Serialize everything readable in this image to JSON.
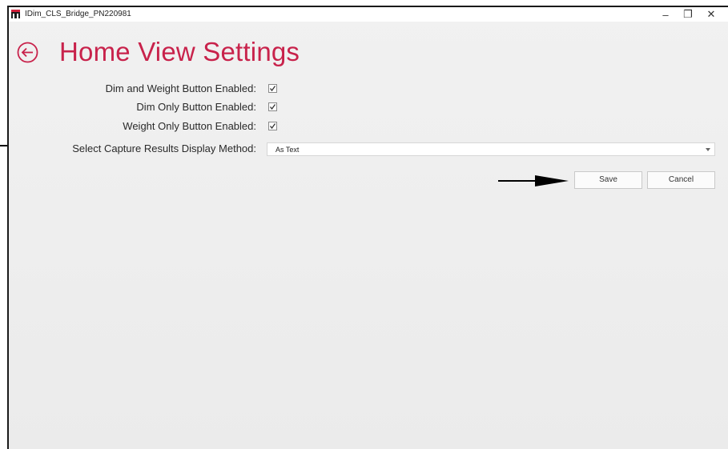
{
  "window": {
    "title": "IDim_CLS_Bridge_PN220981",
    "minimize_glyph": "–",
    "restore_glyph": "❐",
    "close_glyph": "✕"
  },
  "page": {
    "title": "Home View Settings",
    "back_icon": "back-arrow-circle-icon"
  },
  "settings": {
    "dim_and_weight": {
      "label": "Dim and Weight Button Enabled:",
      "checked": true
    },
    "dim_only": {
      "label": "Dim Only Button Enabled:",
      "checked": true
    },
    "weight_only": {
      "label": "Weight Only Button Enabled:",
      "checked": true
    },
    "capture_display": {
      "label": "Select Capture Results Display Method:",
      "value": "As Text"
    }
  },
  "actions": {
    "save_label": "Save",
    "cancel_label": "Cancel"
  },
  "colors": {
    "title": "#c8224b",
    "background": "#eeeeee"
  }
}
